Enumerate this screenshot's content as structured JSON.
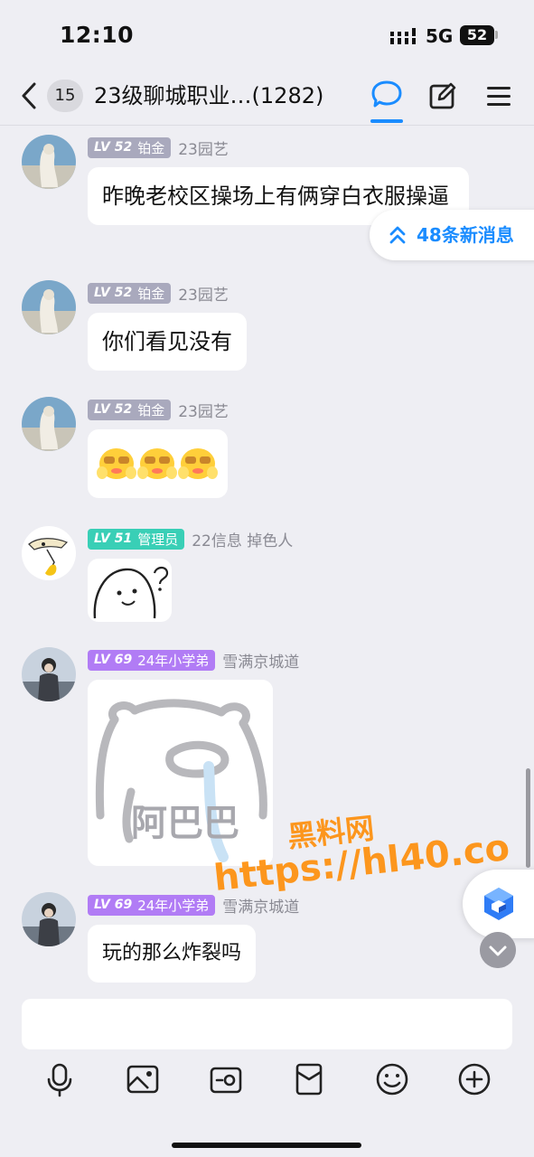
{
  "status_bar": {
    "time": "12:10",
    "network": "5G",
    "battery": "52"
  },
  "nav": {
    "unread_count": "15",
    "title": "23级聊城职业…(1282)"
  },
  "new_messages_pill": {
    "label": "48条新消息"
  },
  "colors": {
    "accent": "#1a8cff",
    "badge_platinum": "#a9a9bd",
    "badge_admin": "#39cfb6",
    "badge_purple": "#b17cf5",
    "watermark": "#ff8a00"
  },
  "messages": [
    {
      "level": "LV 52",
      "title": "铂金",
      "sender": "23园艺",
      "text": "昨晚老校区操场上有俩穿白衣服操逼"
    },
    {
      "level": "LV 52",
      "title": "铂金",
      "sender": "23园艺",
      "text": "你们看见没有"
    },
    {
      "level": "LV 52",
      "title": "铂金",
      "sender": "23园艺",
      "sticker": "emoji-faces"
    },
    {
      "level": "LV 51",
      "title": "管理员",
      "sender": "22信息 掉色人",
      "sticker": "doodle-face"
    },
    {
      "level": "LV 69",
      "title": "24年小学弟",
      "sender": "雪满京城道",
      "sticker": "阿巴巴"
    },
    {
      "level": "LV 69",
      "title": "24年小学弟",
      "sender": "雪满京城道",
      "text": "玩的那么炸裂吗"
    }
  ],
  "watermark": {
    "line1": "黑料网",
    "line2": "https://hl40.co"
  },
  "input": {
    "placeholder": ""
  },
  "toolbar": [
    "mic-icon",
    "image-icon",
    "camera-icon",
    "red-envelope-icon",
    "emoji-icon",
    "plus-icon"
  ]
}
